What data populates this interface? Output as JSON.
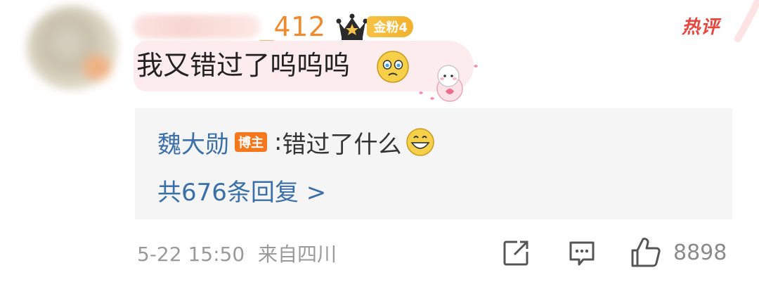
{
  "comment": {
    "username_suffix": "_412",
    "fan_badge": "金粉4",
    "hot_label": "热评",
    "text": "我又错过了呜呜呜",
    "date_time": "5-22 15:50",
    "location": "来自四川",
    "like_count": "8898"
  },
  "reply": {
    "author": "魏大勋",
    "author_badge": "博主",
    "separator": ":",
    "text": "错过了什么",
    "total_replies": "共676条回复 >"
  },
  "icons": [
    "avatar",
    "crown-icon",
    "sad-emoji-icon",
    "sheep-sticker",
    "grin-emoji-icon",
    "edit-icon",
    "comment-icon",
    "like-icon"
  ],
  "colors": {
    "username": "#f08a2c",
    "fan_badge": "#f6c344",
    "hot_label": "#e8453c",
    "link_blue": "#3a6fa8",
    "blogger_badge": "#f5781f",
    "bubble_bg": "#fcecee",
    "reply_bg": "#f5f5f5"
  }
}
